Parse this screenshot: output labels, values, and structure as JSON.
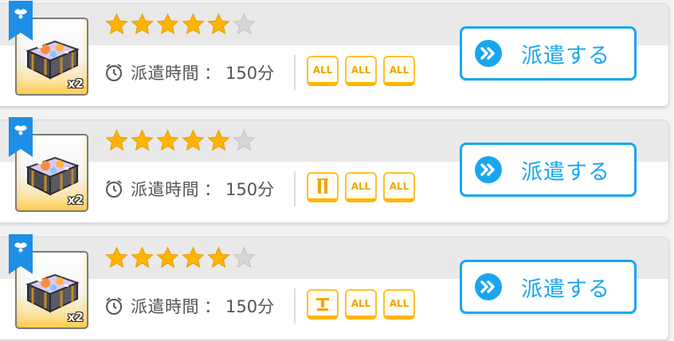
{
  "accent_color": "#19a6ef",
  "star_color": "#ffb400",
  "missions": [
    {
      "stars_filled": 5,
      "stars_total": 6,
      "time_label": "派遣時間",
      "time_sep": "：",
      "time_value": "150分",
      "quantity": "x2",
      "icons": {
        "ribbon": "bookmark-ribbon-icon",
        "clock": "alarm-clock-icon",
        "reward": "treasure-chest-icon"
      },
      "badges": [
        {
          "type": "text",
          "label": "ALL"
        },
        {
          "type": "text",
          "label": "ALL"
        },
        {
          "type": "text",
          "label": "ALL"
        }
      ],
      "button_label": "派遣する"
    },
    {
      "stars_filled": 5,
      "stars_total": 6,
      "time_label": "派遣時間",
      "time_sep": "：",
      "time_value": "150分",
      "quantity": "x2",
      "icons": {
        "ribbon": "bookmark-ribbon-icon",
        "clock": "alarm-clock-icon",
        "reward": "treasure-chest-icon"
      },
      "badges": [
        {
          "type": "icon",
          "icon": "pillar-class-icon"
        },
        {
          "type": "text",
          "label": "ALL"
        },
        {
          "type": "text",
          "label": "ALL"
        }
      ],
      "button_label": "派遣する"
    },
    {
      "stars_filled": 5,
      "stars_total": 6,
      "time_label": "派遣時間",
      "time_sep": "：",
      "time_value": "150分",
      "quantity": "x2",
      "icons": {
        "ribbon": "bookmark-ribbon-icon",
        "clock": "alarm-clock-icon",
        "reward": "treasure-chest-icon"
      },
      "badges": [
        {
          "type": "icon",
          "icon": "anvil-class-icon"
        },
        {
          "type": "text",
          "label": "ALL"
        },
        {
          "type": "text",
          "label": "ALL"
        }
      ],
      "button_label": "派遣する"
    }
  ]
}
